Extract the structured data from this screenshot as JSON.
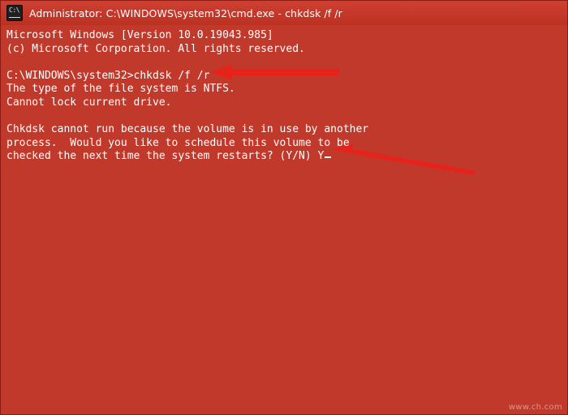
{
  "window": {
    "title": "Administrator: C:\\WINDOWS\\system32\\cmd.exe - chkdsk  /f /r",
    "icon": "cmd-console-icon",
    "background_color": "#c0392b",
    "text_color": "#ffffff"
  },
  "console": {
    "lines": [
      "Microsoft Windows [Version 10.0.19043.985]",
      "(c) Microsoft Corporation. All rights reserved.",
      "",
      "C:\\WINDOWS\\system32>chkdsk /f /r",
      "The type of the file system is NTFS.",
      "Cannot lock current drive.",
      "",
      "Chkdsk cannot run because the volume is in use by another",
      "process.  Would you like to schedule this volume to be",
      "checked the next time the system restarts? (Y/N) Y"
    ],
    "cursor_visible": true
  },
  "annotations": [
    {
      "name": "arrow-pointing-to-chkdsk-command",
      "color": "#e8211a",
      "points_to": "chkdsk /f /r"
    },
    {
      "name": "arrow-pointing-to-confirmation-answer",
      "color": "#e8211a",
      "points_to": "(Y/N) Y"
    }
  ],
  "watermark": {
    "text": "www.ch.com"
  }
}
